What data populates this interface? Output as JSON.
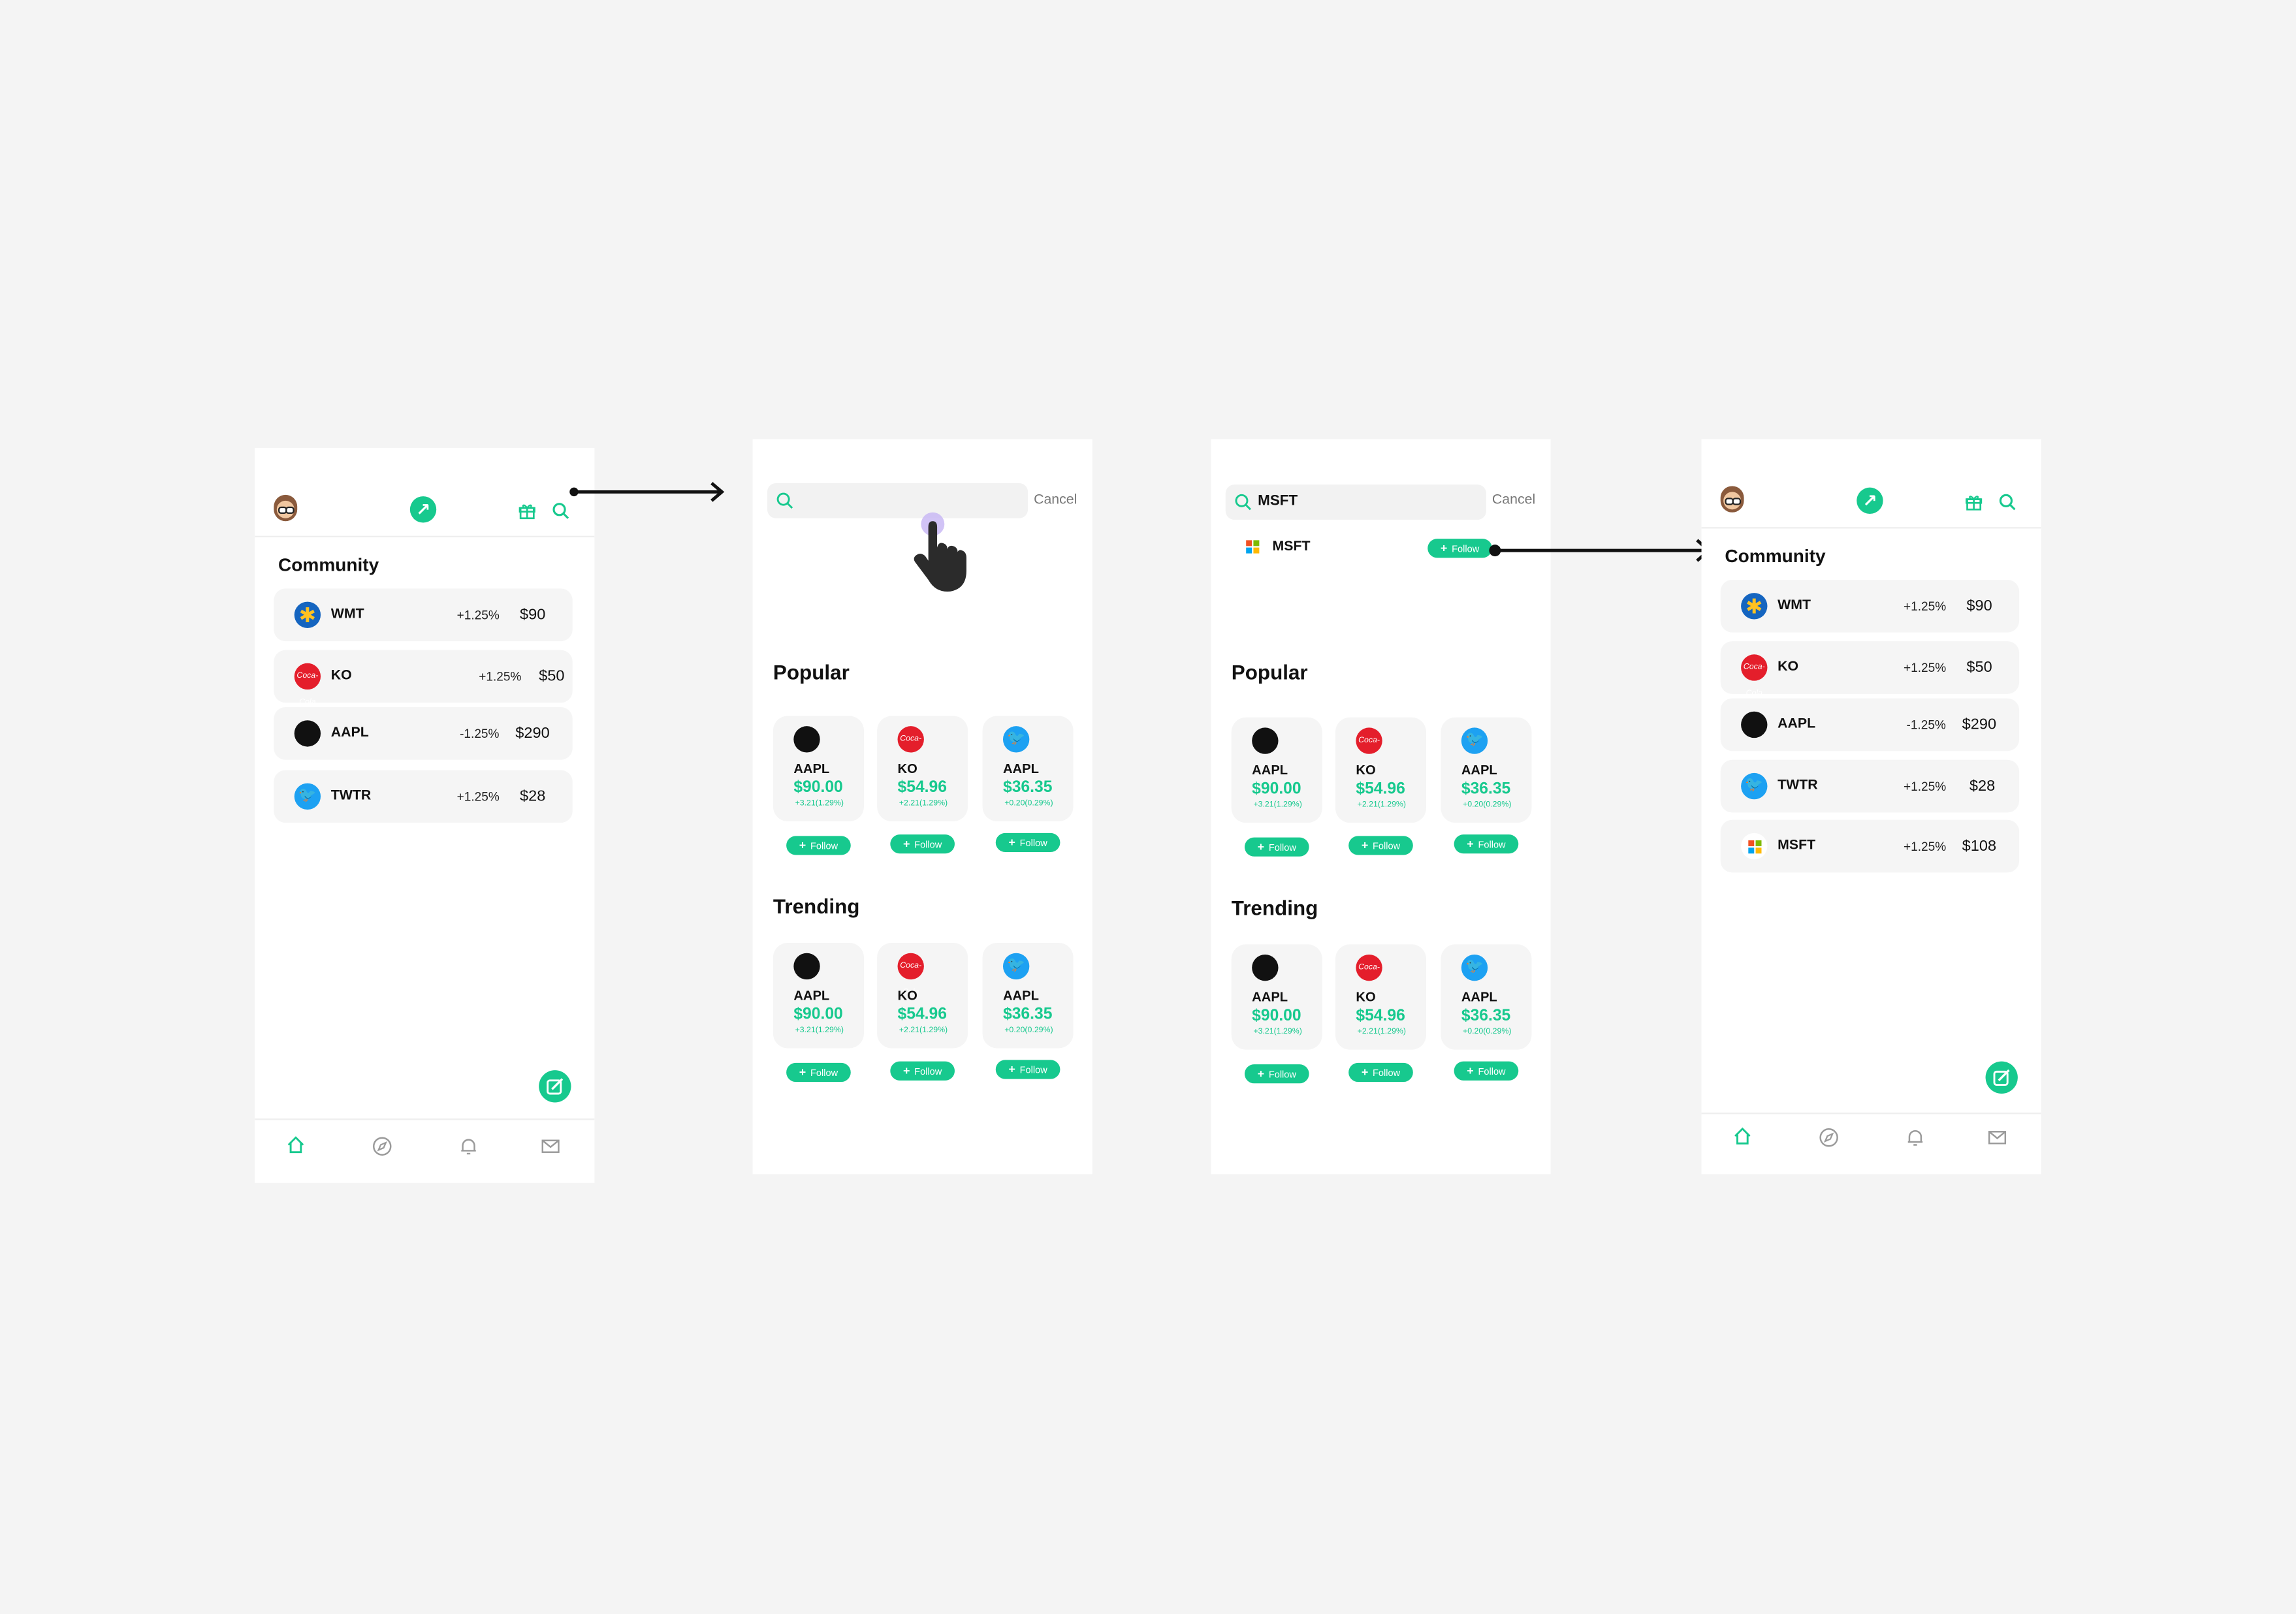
{
  "colors": {
    "accent": "#17c98e",
    "bg": "#f4f4f4",
    "card": "#f5f5f5",
    "text": "#111111"
  },
  "screen1": {
    "community_title": "Community",
    "stocks": [
      {
        "ticker": "WMT",
        "change": "+1.25%",
        "price": "$90",
        "icon": "walmart-icon"
      },
      {
        "ticker": "KO",
        "change": "+1.25%",
        "price": "$50",
        "icon": "coca-cola-icon"
      },
      {
        "ticker": "AAPL",
        "change": "-1.25%",
        "price": "$290",
        "icon": "apple-icon"
      },
      {
        "ticker": "TWTR",
        "change": "+1.25%",
        "price": "$28",
        "icon": "twitter-icon"
      }
    ],
    "nav": [
      "home-icon",
      "compass-icon",
      "bell-icon",
      "mail-icon"
    ]
  },
  "search": {
    "cancel_label": "Cancel",
    "empty_value": "",
    "typed_value": "MSFT",
    "result": {
      "ticker": "MSFT",
      "follow_label": "Follow"
    },
    "popular_title": "Popular",
    "trending_title": "Trending",
    "cards": [
      {
        "ticker": "AAPL",
        "price": "$90.00",
        "change": "+3.21(1.29%)",
        "icon": "apple-icon"
      },
      {
        "ticker": "KO",
        "price": "$54.96",
        "change": "+2.21(1.29%)",
        "icon": "coca-cola-icon"
      },
      {
        "ticker": "AAPL",
        "price": "$36.35",
        "change": "+0.20(0.29%)",
        "icon": "twitter-icon"
      }
    ],
    "follow_label": "Follow"
  },
  "screen4": {
    "community_title": "Community",
    "stocks": [
      {
        "ticker": "WMT",
        "change": "+1.25%",
        "price": "$90"
      },
      {
        "ticker": "KO",
        "change": "+1.25%",
        "price": "$50"
      },
      {
        "ticker": "AAPL",
        "change": "-1.25%",
        "price": "$290"
      },
      {
        "ticker": "TWTR",
        "change": "+1.25%",
        "price": "$28"
      },
      {
        "ticker": "MSFT",
        "change": "+1.25%",
        "price": "$108"
      }
    ]
  },
  "icon_glyphs": {
    "walmart": "✱",
    "coca_cola": "Coca-Cola",
    "apple": "",
    "twitter": "🐦"
  }
}
